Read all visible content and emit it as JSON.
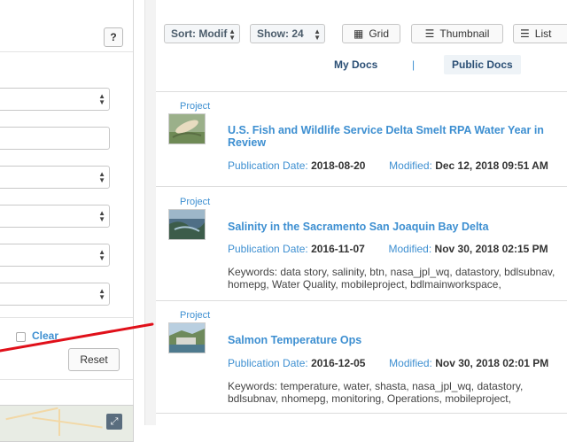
{
  "left_panel": {
    "help_label": "?",
    "clear_label": "Clear",
    "reset_label": "Reset"
  },
  "toolbar": {
    "sort_label": "Sort: Modif",
    "show_label": "Show: 24",
    "grid_label": "Grid",
    "thumbnail_label": "Thumbnail",
    "list_label": "List"
  },
  "tabs": {
    "my_docs": "My Docs",
    "separator": "|",
    "public_docs": "Public Docs"
  },
  "results": [
    {
      "type": "Project",
      "title": "U.S. Fish and Wildlife Service Delta Smelt RPA Water Year in Review",
      "pub_label": "Publication Date:",
      "pub_date": "2018-08-20",
      "mod_label": "Modified:",
      "modified": "Dec 12, 2018 09:51 AM",
      "keywords": ""
    },
    {
      "type": "Project",
      "title": "Salinity in the Sacramento San Joaquin Bay Delta",
      "pub_label": "Publication Date:",
      "pub_date": "2016-11-07",
      "mod_label": "Modified:",
      "modified": "Nov 30, 2018 02:15 PM",
      "keywords": "Keywords: data story, salinity, btn, nasa_jpl_wq, datastory, bdlsubnav, homepg, Water Quality, mobileproject, bdlmainworkspace,"
    },
    {
      "type": "Project",
      "title": "Salmon Temperature Ops",
      "pub_label": "Publication Date:",
      "pub_date": "2016-12-05",
      "mod_label": "Modified:",
      "modified": "Nov 30, 2018 02:01 PM",
      "keywords": "Keywords: temperature, water, shasta, nasa_jpl_wq, datastory, bdlsubnav, nhomepg, monitoring, Operations, mobileproject,"
    }
  ],
  "colors": {
    "link": "#3d8fd1",
    "annotation": "#e0101a"
  },
  "icons": {
    "grid": "grid-icon",
    "thumbnail": "thumbnail-icon",
    "list": "list-icon",
    "expand": "expand-icon"
  }
}
